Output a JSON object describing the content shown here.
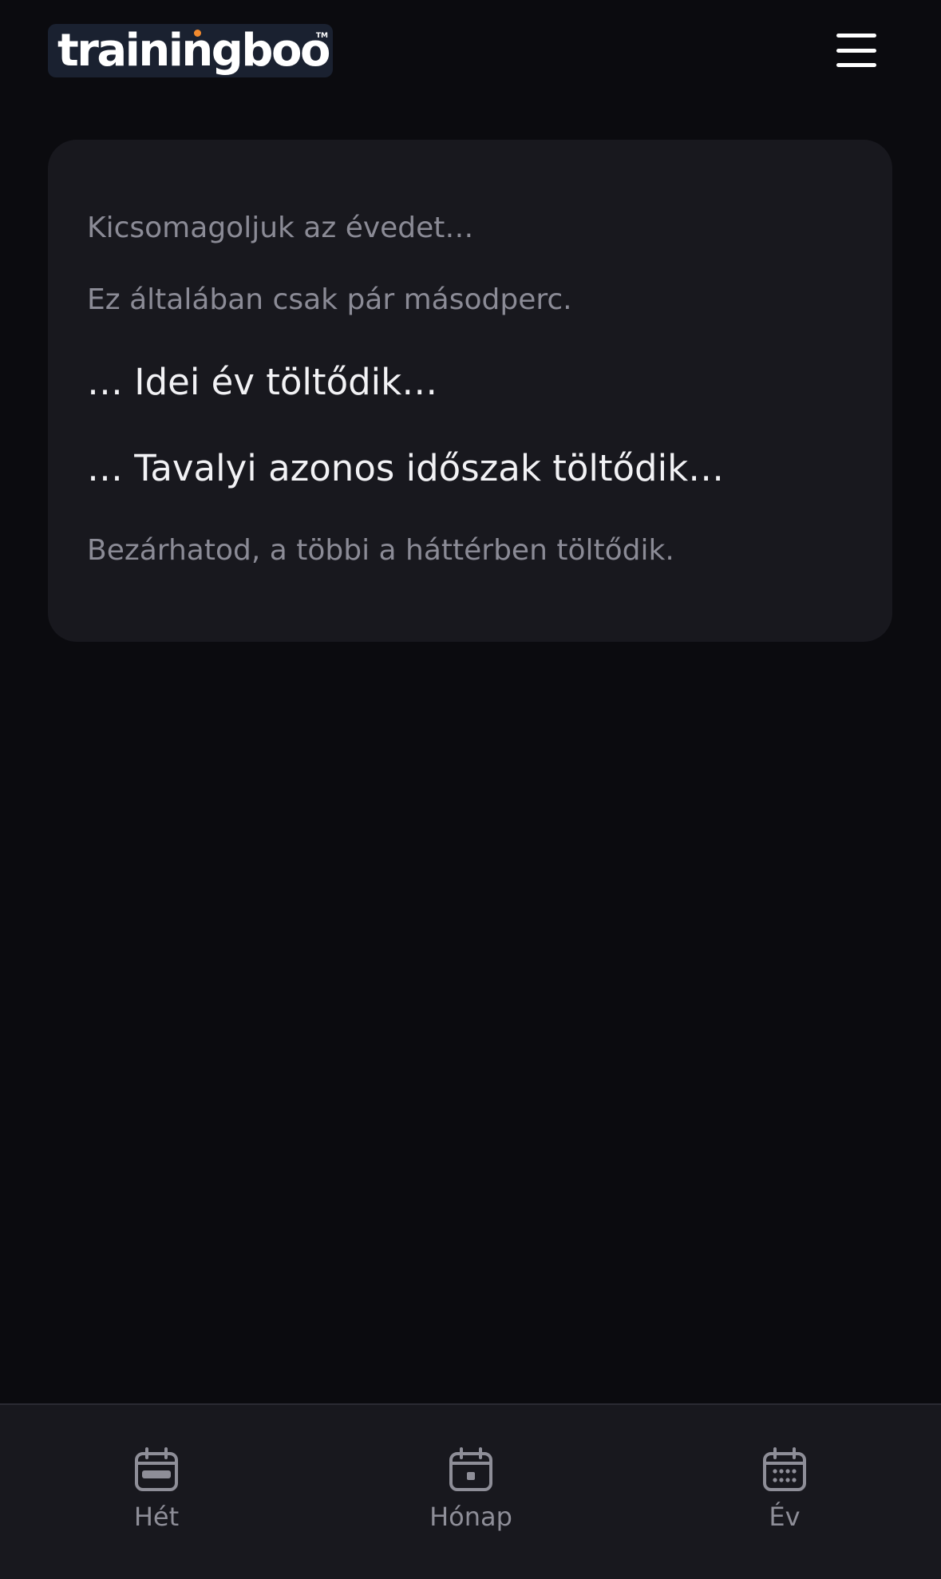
{
  "header": {
    "logo_text": "trainingboo",
    "logo_tm": "TM"
  },
  "loading": {
    "line1": "Kicsomagoljuk az évedet…",
    "line2": "Ez általában csak pár másodperc.",
    "line3": "… Idei év töltődik…",
    "line4": "… Tavalyi azonos időszak töltődik…",
    "line5": "Bezárhatod, a többi a háttérben töltődik."
  },
  "bottom_nav": {
    "items": [
      {
        "label": "Hét",
        "icon": "calendar-week-icon"
      },
      {
        "label": "Hónap",
        "icon": "calendar-month-icon"
      },
      {
        "label": "Év",
        "icon": "calendar-year-icon"
      }
    ]
  },
  "colors": {
    "background": "#0b0b0f",
    "card": "#18181e",
    "muted_text": "#8b8b96",
    "strong_text": "#f2f2f5",
    "logo_accent": "#f28a2e"
  }
}
